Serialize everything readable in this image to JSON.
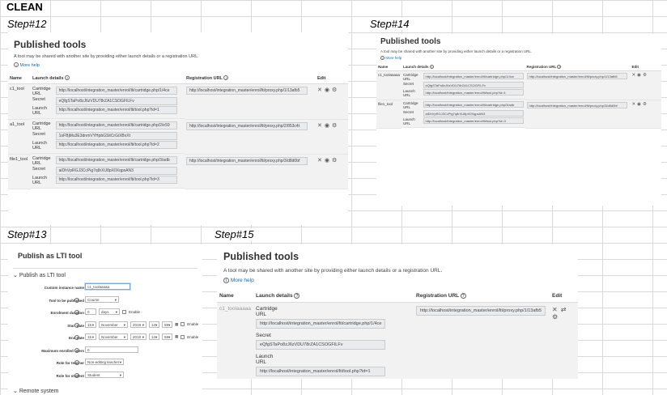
{
  "sheet": {
    "clean_label": "CLEAN",
    "step12": "Step#12",
    "step13": "Step#13",
    "step14": "Step#14",
    "step15": "Step#15"
  },
  "published": {
    "title": "Published tools",
    "description": "A tool may be shared with another site by providing either launch details or a registration URL.",
    "more_help": "More help",
    "col_name": "Name",
    "col_launch": "Launch details",
    "col_registration": "Registration URL",
    "col_edit": "Edit",
    "label_cartridge": "Cartridge",
    "label_url": "URL",
    "label_secret": "Secret",
    "label_launch": "Launch"
  },
  "step12_tools": [
    {
      "name": "c1_tool",
      "cartridge_url": "http://localhost/integration_master/enrol/lti/cartridge.php/1/4ce",
      "secret": "eQfgSTaPo8zJ6zVDU78rZA1CSOGFILFv",
      "launch_url": "http://localhost/integration_master/enrol/lti/tool.php?id=1",
      "registration_url": "http://localhost/integration_master/enrol/lti/proxy.php/1/13afb5"
    },
    {
      "name": "a1_tool",
      "cartridge_url": "http://localhost/integration_master/enrol/lti/cartridge.php/2/e59",
      "secret": "1oFBjMu3E3dnmVYHpbGSitCrGiXBvXt",
      "launch_url": "http://localhost/integration_master/enrol/lti/tool.php?id=2",
      "registration_url": "http://localhost/integration_master/enrol/lti/proxy.php/2/853c4t"
    },
    {
      "name": "file1_tool",
      "cartridge_url": "http://localhost/integration_master/enrol/lti/cartridge.php/3/adb",
      "secret": "aiDhVpRGJ3CcPig7q8rXU8pX0XqpsAN3",
      "launch_url": "http://localhost/integration_master/enrol/lti/tool.php?id=3",
      "registration_url": "http://localhost/integration_master/enrol/lti/proxy.php/3/d8d0bf"
    }
  ],
  "step14_tools": [
    {
      "name": "c1_toolaaaaa",
      "cartridge_url": "http://localhost/integration_master/enrol/lti/cartridge.php/1/4ce",
      "secret": "eQfgSTaPo8zJ6zVDU78rZA1CSOGFILFv",
      "launch_url": "http://localhost/integration_master/enrol/lti/tool.php?id=1",
      "registration_url": "http://localhost/integration_master/enrol/lti/proxy.php/1/13afb5"
    },
    {
      "name": "file1_tool",
      "cartridge_url": "http://localhost/integration_master/enrol/lti/cartridge.php/3/adb",
      "secret": "aiDhVpRGJ3CcPig7q8rXU8pX0XqpsAN3",
      "launch_url": "http://localhost/integration_master/enrol/lti/tool.php?id=3",
      "registration_url": "http://localhost/integration_master/enrol/lti/proxy.php/3/d8d0bf"
    }
  ],
  "step15_tool": {
    "name": "c1_toolaaaaa",
    "cartridge_url": "http://localhost/integration_master/enrol/lti/cartridge.php/1/4ce",
    "secret": "eQfgSTaPo8zJ6zVDU78rZA1CSOGFILFv",
    "launch_url": "http://localhost/integration_master/enrol/lti/tool.php?id=1",
    "registration_url": "http://localhost/integration_master/enrol/lti/proxy.php/1/13afb5"
  },
  "lti_form": {
    "title": "Publish as LTI tool",
    "section": "Publish as LTI tool",
    "remote_section": "Remote system",
    "custom_name_label": "Custom instance name",
    "custom_name_value": "c1_toolaaaaa",
    "tool_label": "Tool to be published",
    "tool_value": "Course",
    "enrol_duration_label": "Enrolment duration",
    "enrol_duration_value": "0",
    "enrol_duration_unit": "days",
    "enable_label": "Enable",
    "start_date_label": "Start date",
    "end_date_label": "End date",
    "date_day": "15",
    "date_month": "November",
    "date_year": "2018",
    "date_hour": "14",
    "date_minute": "59",
    "max_users_label": "Maximum enrolled users",
    "max_users_value": "0",
    "role_teacher_label": "Role for teacher",
    "role_teacher_value": "Non-editing teacher",
    "role_student_label": "Role for student",
    "role_student_value": "Student"
  }
}
